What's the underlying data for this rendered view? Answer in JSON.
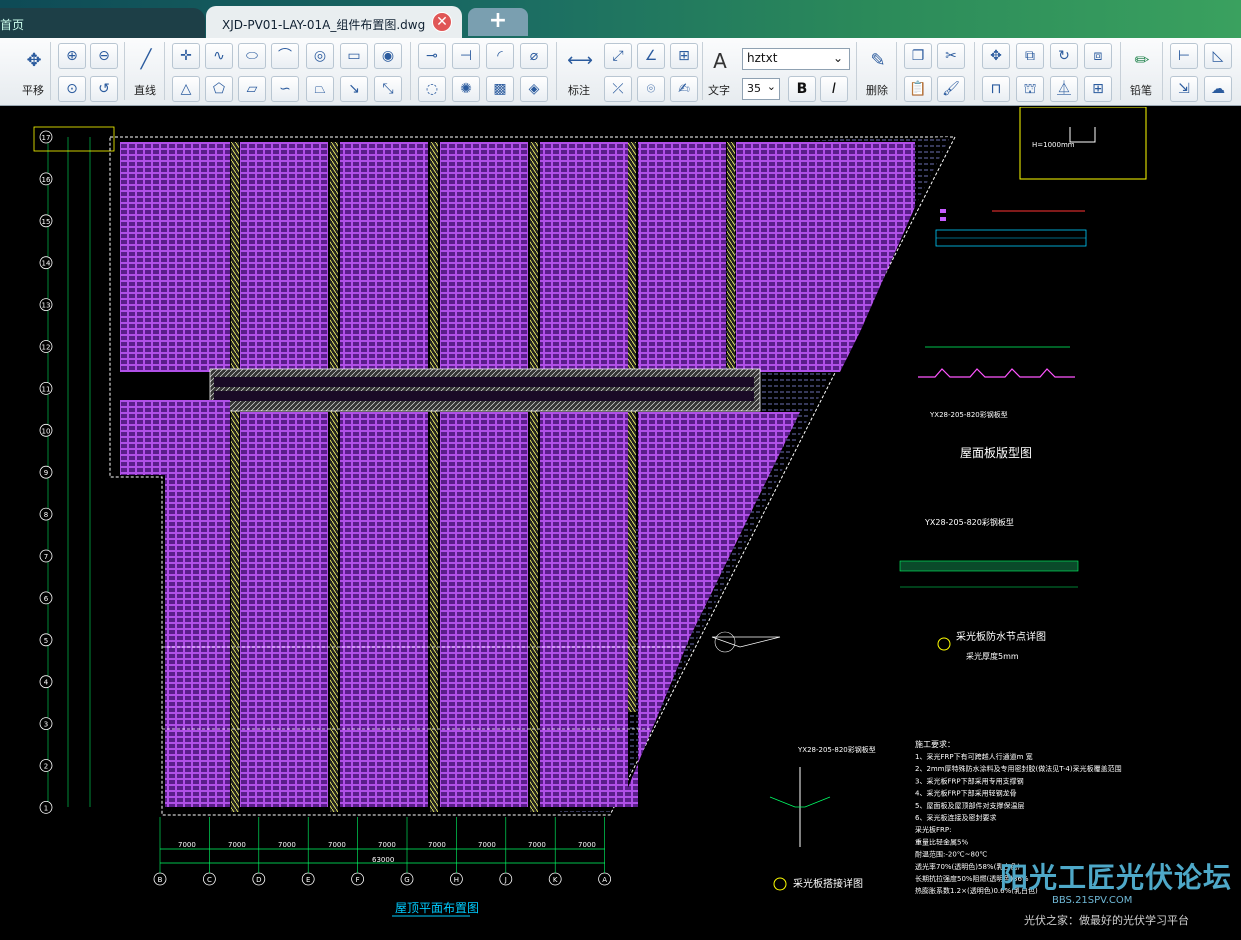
{
  "tabs": {
    "home_label": "首页",
    "active_label": "XJD-PV01-LAY-01A_组件布置图.dwg",
    "close_symbol": "✕",
    "new_symbol": "+"
  },
  "toolbar": {
    "pan_label": "平移",
    "line_label": "直线",
    "dimension_label": "标注",
    "text_label": "文字",
    "font_name": "hztxt",
    "font_size": "35",
    "bold_label": "B",
    "italic_label": "I",
    "delete_label": "删除",
    "pencil_label": "铅笔"
  },
  "drawing": {
    "plan_title": "屋顶平面布置图",
    "roof_panel_title": "屋面板版型图",
    "panel_spec": "YX28-205-820彩钢板型",
    "waterproof_title": "采光板防水节点详图",
    "waterproof_sub": "采光厚度5mm",
    "joint_title": "采光板搭接详图",
    "joint_spec": "YX28-205-820彩钢板型",
    "detail_label": "H=1000mm",
    "dim_7000": "7000",
    "overall_dim": "63000",
    "notes_title": "施工要求：",
    "notes": [
      "1、采光FRP下有可跨越人行通道m 宽",
      "2、2mm厚特殊防水涂料及专用密封胶(做法见T-4)采光板覆盖范围",
      "3、采光板FRP下部采用专用支撑钢",
      "4、采光板FRP下部采用轻钢龙骨",
      "5、屋面板及屋顶部件对支撑保温层",
      "6、采光板连接及密封要求",
      "采光板FRP:",
      "重量比轻金属5%",
      "耐温范围:-20℃~80℃",
      "透光率70%(透明色)58%(乳白色)",
      "长期抗拉强度50%阻燃(透明色)36%",
      "热膨胀系数1.2×(透明色)0.6%(乳白色)"
    ],
    "axis_letters": [
      "B",
      "C",
      "D",
      "E",
      "F",
      "G",
      "H",
      "J",
      "K",
      "A"
    ],
    "axis_numbers": [
      "17",
      "16",
      "15",
      "14",
      "13",
      "12",
      "11",
      "10",
      "9",
      "8",
      "7",
      "6",
      "5",
      "4",
      "3",
      "2",
      "1"
    ]
  },
  "watermark": {
    "brand": "阳光工匠光伏论坛",
    "url": "BBS.21SPV.COM",
    "slogan": "光伏之家：做最好的光伏学习平台"
  },
  "colors": {
    "panel": "#b64cff",
    "grid": "#00ff66",
    "dashed": "#ffffff",
    "label_yellow": "#ffff00"
  }
}
